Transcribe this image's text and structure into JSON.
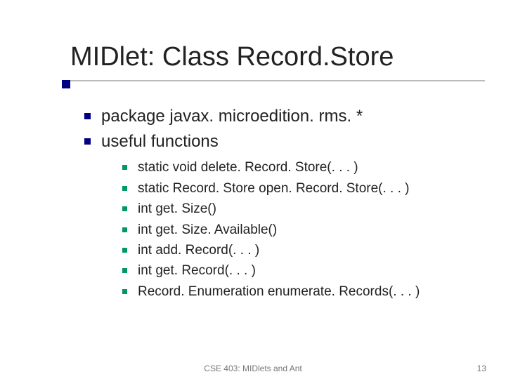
{
  "title": "MIDlet: Class Record.Store",
  "bullets": {
    "level1": [
      "package javax. microedition. rms. *",
      "useful functions"
    ],
    "level2": [
      "static void delete. Record. Store(. . . )",
      "static Record. Store open. Record. Store(. . . )",
      "int get. Size()",
      "int get. Size. Available()",
      "int add. Record(. . . )",
      "int get. Record(. . . )",
      "Record. Enumeration enumerate. Records(. . . )"
    ]
  },
  "footer": {
    "center": "CSE 403: MIDlets and Ant",
    "page": "13"
  }
}
